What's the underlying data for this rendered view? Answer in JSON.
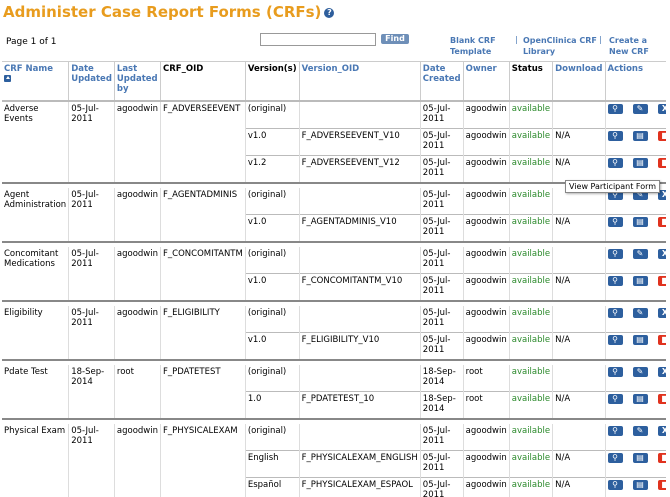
{
  "title": "Administer Case Report Forms (CRFs)",
  "page_label": "Page 1 of 1",
  "find_label": "Find",
  "links": {
    "blank_template": [
      "Blank CRF",
      "Template"
    ],
    "openclinica_library": [
      "OpenClinica CRF",
      "Library"
    ],
    "create_new": [
      "Create a",
      "New CRF"
    ]
  },
  "headers": [
    "CRF Name",
    "Date Updated",
    "Last Updated by",
    "CRF_OID",
    "Version(s)",
    "Version_OID",
    "Date Created",
    "Owner",
    "Status",
    "Download",
    "Actions"
  ],
  "tooltip": "View Participant Form",
  "rows": [
    {
      "name": "Adverse Events",
      "date": "05-Jul-2011",
      "by": "agoodwin",
      "oid": "F_ADVERSEEVENT",
      "versions": [
        {
          "v": "(original)",
          "voi": "",
          "dc": "05-Jul-2011",
          "own": "agoodwin",
          "st": "available",
          "dl": ""
        },
        {
          "v": "v1.0",
          "voi": "F_ADVERSEEVENT_V10",
          "dc": "05-Jul-2011",
          "own": "agoodwin",
          "st": "available",
          "dl": "N/A"
        },
        {
          "v": "v1.2",
          "voi": "F_ADVERSEEVENT_V12",
          "dc": "05-Jul-2011",
          "own": "agoodwin",
          "st": "available",
          "dl": "N/A"
        }
      ]
    },
    {
      "name": "Agent Administration",
      "date": "05-Jul-2011",
      "by": "agoodwin",
      "oid": "F_AGENTADMINIS",
      "versions": [
        {
          "v": "(original)",
          "voi": "",
          "dc": "05-Jul-2011",
          "own": "agoodwin",
          "st": "available",
          "dl": ""
        },
        {
          "v": "v1.0",
          "voi": "F_AGENTADMINIS_V10",
          "dc": "05-Jul-2011",
          "own": "agoodwin",
          "st": "available",
          "dl": "N/A"
        }
      ]
    },
    {
      "name": "Concomitant Medications",
      "date": "05-Jul-2011",
      "by": "agoodwin",
      "oid": "F_CONCOMITANTM",
      "versions": [
        {
          "v": "(original)",
          "voi": "",
          "dc": "05-Jul-2011",
          "own": "agoodwin",
          "st": "available",
          "dl": ""
        },
        {
          "v": "v1.0",
          "voi": "F_CONCOMITANTM_V10",
          "dc": "05-Jul-2011",
          "own": "agoodwin",
          "st": "available",
          "dl": "N/A"
        }
      ]
    },
    {
      "name": "Eligibility",
      "date": "05-Jul-2011",
      "by": "agoodwin",
      "oid": "F_ELIGIBILITY",
      "versions": [
        {
          "v": "(original)",
          "voi": "",
          "dc": "05-Jul-2011",
          "own": "agoodwin",
          "st": "available",
          "dl": ""
        },
        {
          "v": "v1.0",
          "voi": "F_ELIGIBILITY_V10",
          "dc": "05-Jul-2011",
          "own": "agoodwin",
          "st": "available",
          "dl": "N/A"
        }
      ]
    },
    {
      "name": "Pdate Test",
      "date": "18-Sep-2014",
      "by": "root",
      "oid": "F_PDATETEST",
      "versions": [
        {
          "v": "(original)",
          "voi": "",
          "dc": "18-Sep-2014",
          "own": "root",
          "st": "available",
          "dl": ""
        },
        {
          "v": "1.0",
          "voi": "F_PDATETEST_10",
          "dc": "18-Sep-2014",
          "own": "root",
          "st": "available",
          "dl": "N/A"
        }
      ]
    },
    {
      "name": "Physical Exam",
      "date": "05-Jul-2011",
      "by": "agoodwin",
      "oid": "F_PHYSICALEXAM",
      "versions": [
        {
          "v": "(original)",
          "voi": "",
          "dc": "05-Jul-2011",
          "own": "agoodwin",
          "st": "available",
          "dl": ""
        },
        {
          "v": "English",
          "voi": "F_PHYSICALEXAM_ENGLISH",
          "dc": "05-Jul-2011",
          "own": "agoodwin",
          "st": "available",
          "dl": "N/A"
        },
        {
          "v": "Español",
          "voi": "F_PHYSICALEXAM_ESPAOL",
          "dc": "05-Jul-2011",
          "own": "agoodwin",
          "st": "available",
          "dl": "N/A"
        }
      ]
    }
  ]
}
